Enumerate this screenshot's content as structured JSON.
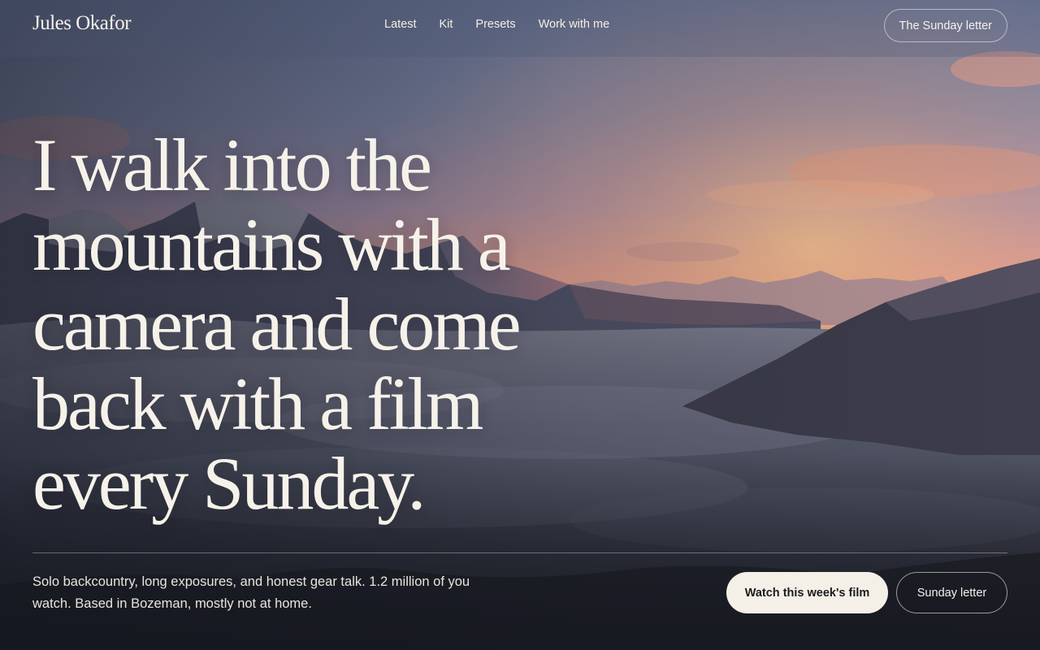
{
  "header": {
    "brand": "Jules Okafor",
    "nav": [
      "Latest",
      "Kit",
      "Presets",
      "Work with me"
    ],
    "cta_label": "The Sunday letter"
  },
  "hero": {
    "headline": "I walk into the mountains with a camera and come back with a film every Sunday.",
    "bio": "Solo backcountry, long exposures, and honest gear talk. 1.2 million of you watch. Based in Bozeman, mostly not at home.",
    "primary_button": "Watch this week's film",
    "secondary_button": "Sunday letter"
  }
}
